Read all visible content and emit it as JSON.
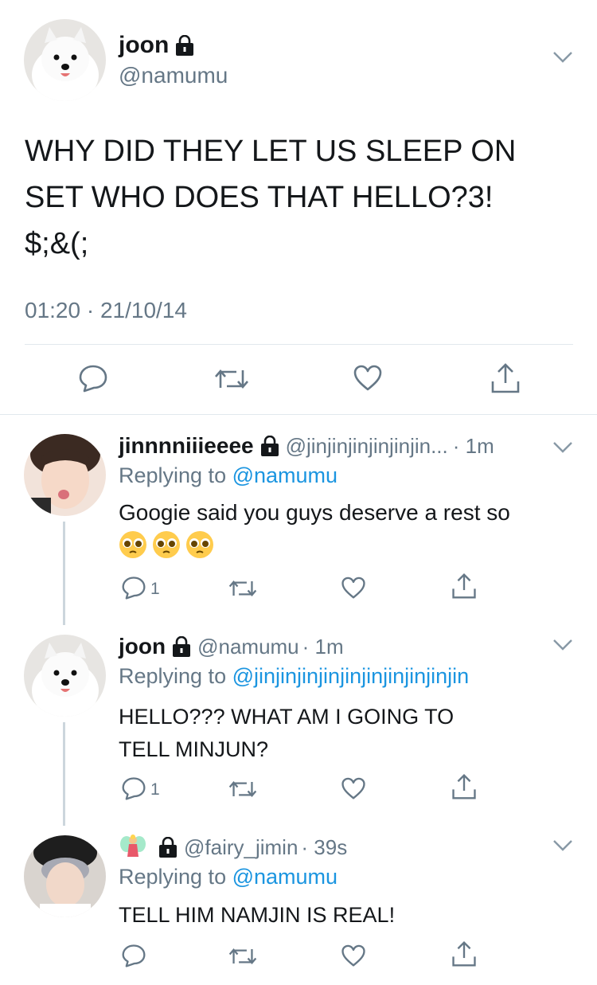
{
  "main_tweet": {
    "display_name": "joon",
    "handle": "@namumu",
    "text_lines": [
      "WHY DID THEY LET US SLEEP ON",
      "SET WHO DOES THAT HELLO?3!",
      "$;&(;"
    ],
    "timestamp": "01:20 · 21/10/14"
  },
  "replies": [
    {
      "display_name": "jinnnniiieeee",
      "handle": "@jinjinjinjinjinjin...",
      "time": "· 1m",
      "replying_prefix": "Replying to",
      "replying_to": "@namumu",
      "text": "Googie said you guys deserve a rest so",
      "reply_count": "1"
    },
    {
      "display_name": "joon",
      "handle": "@namumu",
      "time": "· 1m",
      "replying_prefix": "Replying to",
      "replying_to": "@jinjinjinjinjinjinjinjinjinjin",
      "text_lines": [
        "HELLO??? WHAT AM I GOING TO",
        "TELL MINJUN?"
      ],
      "reply_count": "1"
    },
    {
      "display_name_icon": "fairy-emoji",
      "handle": "@fairy_jimin",
      "time": "· 39s",
      "replying_prefix": "Replying to",
      "replying_to": "@namumu",
      "text": "TELL HIM NAMJIN IS REAL!"
    }
  ],
  "colors": {
    "accent": "#1b95e0",
    "secondary_text": "#657786",
    "divider": "#e1e8ed",
    "icon": "#657786"
  }
}
